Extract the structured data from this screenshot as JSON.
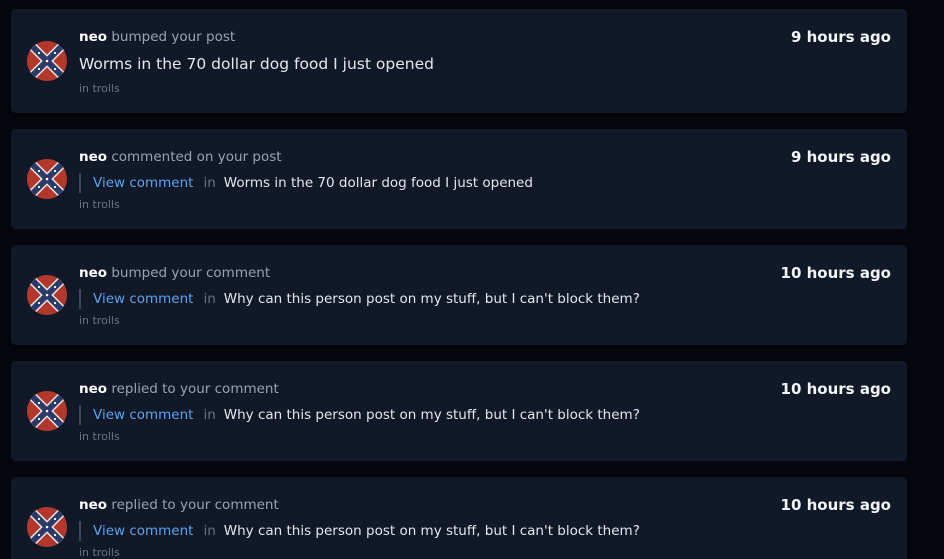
{
  "notifications": [
    {
      "user": "neo",
      "action": "bumped your post",
      "time": "9 hours ago",
      "post_title": "Worms in the 70 dollar dog food I just opened",
      "community": "in trolls"
    },
    {
      "user": "neo",
      "action": "commented on your post",
      "time": "9 hours ago",
      "link_label": "View comment",
      "in_label": "in",
      "post_title": "Worms in the 70 dollar dog food I just opened",
      "community": "in trolls"
    },
    {
      "user": "neo",
      "action": "bumped your comment",
      "time": "10 hours ago",
      "link_label": "View comment",
      "in_label": "in",
      "post_title": "Why can this person post on my stuff, but I can't block them?",
      "community": "in trolls"
    },
    {
      "user": "neo",
      "action": "replied to your comment",
      "time": "10 hours ago",
      "link_label": "View comment",
      "in_label": "in",
      "post_title": "Why can this person post on my stuff, but I can't block them?",
      "community": "in trolls"
    },
    {
      "user": "neo",
      "action": "replied to your comment",
      "time": "10 hours ago",
      "link_label": "View comment",
      "in_label": "in",
      "post_title": "Why can this person post on my stuff, but I can't block them?",
      "community": "in trolls"
    }
  ],
  "colors": {
    "page_bg": "#04060b",
    "card_bg": "#111827",
    "link": "#5aa4f0",
    "muted": "#9aa3b2",
    "avatar_red": "#b3372b",
    "avatar_cross": "#2b3a6b"
  },
  "icons": {
    "avatar": "flag-avatar-icon"
  }
}
